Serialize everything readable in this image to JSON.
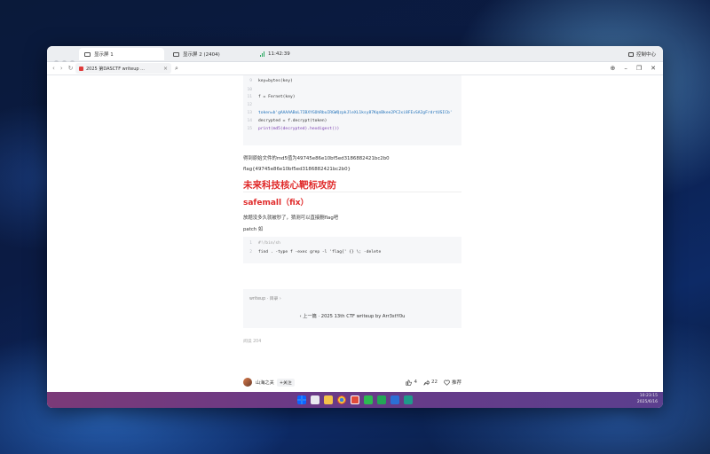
{
  "tabbar": {
    "tabs": [
      {
        "label": "显示屏 1"
      },
      {
        "label": "显示屏 2 (2404)"
      }
    ],
    "latency": "11:42:39",
    "control_center": "控制中心"
  },
  "browser": {
    "tab_title": "2025 第DASCTF writeup ...",
    "nav_glyphs": [
      "‹",
      "›",
      "↻"
    ],
    "search_glyph": "⌕",
    "win_glyphs": [
      "⊕",
      "–",
      "❐",
      "✕"
    ]
  },
  "code1": {
    "lines": [
      {
        "n": "9",
        "text": "key=bytes(key)"
      },
      {
        "n": "10",
        "text": ""
      },
      {
        "n": "11",
        "text": "f = Fernet(key)"
      },
      {
        "n": "12",
        "text": ""
      },
      {
        "n": "13",
        "text": "token=b'gAAAAABoL7IBXYGOhRbuIRGWQzpkJleXL1ksy87KqnBkee2PC2xi8FEvSA2gFrdrtUSICb'"
      },
      {
        "n": "14",
        "text": "decrypted = f.decrypt(token)"
      },
      {
        "n": "15",
        "text": "print(md5(decrypted).hexdigest())"
      }
    ]
  },
  "content": {
    "p1": "得到原始文件的md5值为49745e86e10bf5ed3186882421bc2b0",
    "p2": "flag{49745e86e10bf5ed3186882421bc2b0}",
    "h1": "未来科技核心靶标攻防",
    "h2": "safemall（fix）",
    "p3": "放题没多久就被秒了，猜测可以直接删flag吧",
    "p4": "patch 如"
  },
  "code2": {
    "lines": [
      {
        "n": "1",
        "text": "#!/bin/sh"
      },
      {
        "n": "2",
        "text": "find . -type f -exec grep -l 'flag{' {} \\; -delete"
      }
    ]
  },
  "footer": {
    "tags": "writeup · 目录 ›",
    "prev": "‹ 上一篇 · 2025 13th CTF writeup by Arr3stY0u",
    "read_count": "阅读 204"
  },
  "author": {
    "name": "山海之关",
    "follow": "+关注",
    "likes": "4",
    "shares": "22",
    "recommend": "推荐"
  },
  "taskbar": {
    "time": "10:23:15",
    "date": "2025/6/16"
  }
}
